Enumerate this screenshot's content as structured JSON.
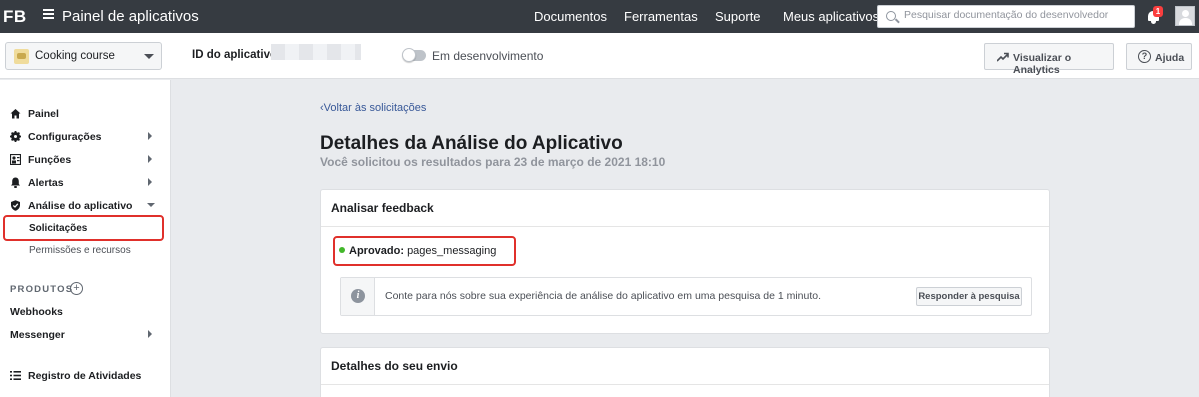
{
  "topbar": {
    "logo": "FB",
    "title": "Painel de aplicativos",
    "nav": [
      "Documentos",
      "Ferramentas",
      "Suporte",
      "Meus aplicativos"
    ],
    "search_placeholder": "Pesquisar documentação do desenvolvedor",
    "notification_count": "1"
  },
  "appbar": {
    "app_name": "Cooking course",
    "app_id_label": "ID do aplicativo:",
    "dev_mode_label": "Em desenvolvimento",
    "analytics_button": "Visualizar o Analytics",
    "help_button": "Ajuda"
  },
  "sidebar": {
    "items": [
      {
        "label": "Painel",
        "icon": "home-icon"
      },
      {
        "label": "Configurações",
        "icon": "gear-icon"
      },
      {
        "label": "Funções",
        "icon": "roles-icon"
      },
      {
        "label": "Alertas",
        "icon": "bell-icon"
      },
      {
        "label": "Análise do aplicativo",
        "icon": "shield-icon"
      }
    ],
    "subitems": [
      "Solicitações",
      "Permissões e recursos"
    ],
    "products_label": "PRODUTOS",
    "products": [
      "Webhooks",
      "Messenger"
    ],
    "activity_log": "Registro de Atividades"
  },
  "main": {
    "back_link": "Voltar às solicitações",
    "title": "Detalhes da Análise do Aplicativo",
    "subtitle": "Você solicitou os resultados para 23 de março de 2021 18:10",
    "feedback_card": {
      "heading": "Analisar feedback",
      "status_label": "Aprovado:",
      "permission": "pages_messaging",
      "survey_text": "Conte para nós sobre sua experiência de análise do aplicativo em uma pesquisa de 1 minuto.",
      "survey_button": "Responder à pesquisa"
    },
    "submission_card": {
      "heading": "Detalhes do seu envio"
    }
  },
  "colors": {
    "topbar": "#363b41",
    "highlight": "#e0302b",
    "approved": "#42b72a",
    "link": "#385898"
  }
}
